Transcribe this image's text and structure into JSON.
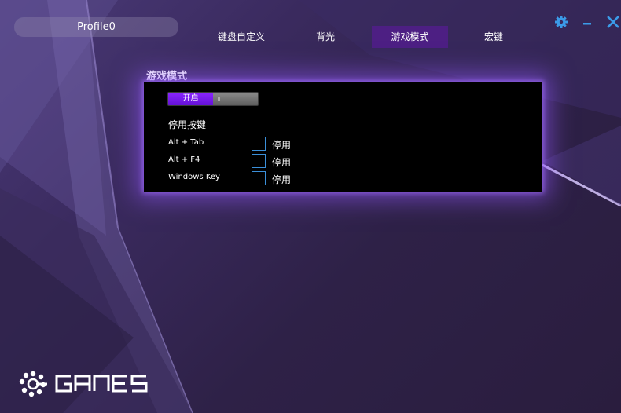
{
  "profile": {
    "name": "Profile0"
  },
  "tabs": [
    {
      "label": "键盘自定义",
      "active": false
    },
    {
      "label": "背光",
      "active": false
    },
    {
      "label": "游戏模式",
      "active": true
    },
    {
      "label": "宏键",
      "active": false
    }
  ],
  "window_controls": {
    "settings_icon": "gear-icon",
    "minimize_icon": "minimize-icon",
    "close_icon": "close-icon",
    "accent": "#3b9be8"
  },
  "game_mode": {
    "title": "游戏模式",
    "toggle_on_label": "开启",
    "toggle_state": "on",
    "disable_keys_label": "停用按键",
    "keys": [
      {
        "name": "Alt + Tab",
        "checkbox_label": "停用",
        "checked": false
      },
      {
        "name": "Alt + F4",
        "checkbox_label": "停用",
        "checked": false
      },
      {
        "name": "Windows Key",
        "checkbox_label": "停用",
        "checked": false
      }
    ]
  },
  "colors": {
    "active_tab": "#4d1f83",
    "toggle_on": "#7a1cf0",
    "checkbox_border": "#3b8fd8",
    "panel_glow": "#965aff"
  }
}
